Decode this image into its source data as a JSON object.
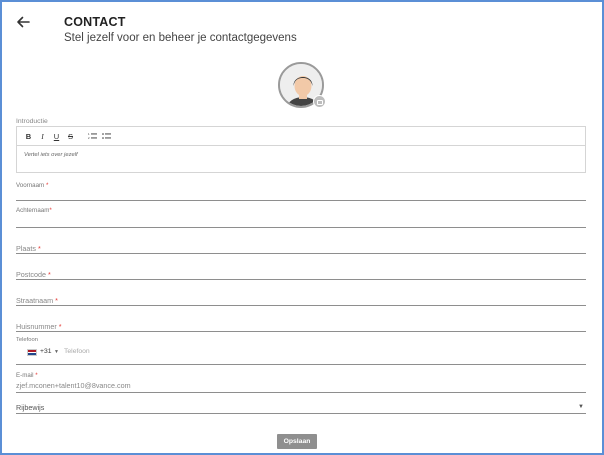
{
  "header": {
    "title": "CONTACT",
    "subtitle": "Stel jezelf voor en beheer je contactgegevens",
    "back_icon": "arrow-left-icon"
  },
  "avatar": {
    "icon": "user-avatar-icon",
    "badge_icon": "camera-icon"
  },
  "intro": {
    "label": "Introductie",
    "toolbar": {
      "bold": "B",
      "italic": "I",
      "underline": "U",
      "strike": "S"
    },
    "placeholder": "Vertel iets over jezelf"
  },
  "fields": {
    "first_name": {
      "label": "Voornaam",
      "required_mark": "*"
    },
    "last_name": {
      "label": "Achternaam",
      "required_mark": "*"
    },
    "city": {
      "label": "Plaats",
      "required_mark": "*"
    },
    "postcode": {
      "label": "Postcode",
      "required_mark": "*"
    },
    "street": {
      "label": "Straatnaam",
      "required_mark": "*"
    },
    "house_number": {
      "label": "Huisnummer",
      "required_mark": "*"
    },
    "phone": {
      "label": "Telefoon",
      "country_code": "+31",
      "placeholder": "Telefoon",
      "flag_colors": [
        "#ae1c28",
        "#ffffff",
        "#21468b"
      ]
    },
    "email": {
      "label": "E-mail",
      "required_mark": "*",
      "value": "zjef.mconen+talent10@8vance.com"
    },
    "license": {
      "label": "Rijbewijs"
    }
  },
  "actions": {
    "save_label": "Opslaan"
  },
  "colors": {
    "frame_border": "#5b8fd6",
    "required": "#e53935",
    "save_button": "#8f8f8f"
  }
}
